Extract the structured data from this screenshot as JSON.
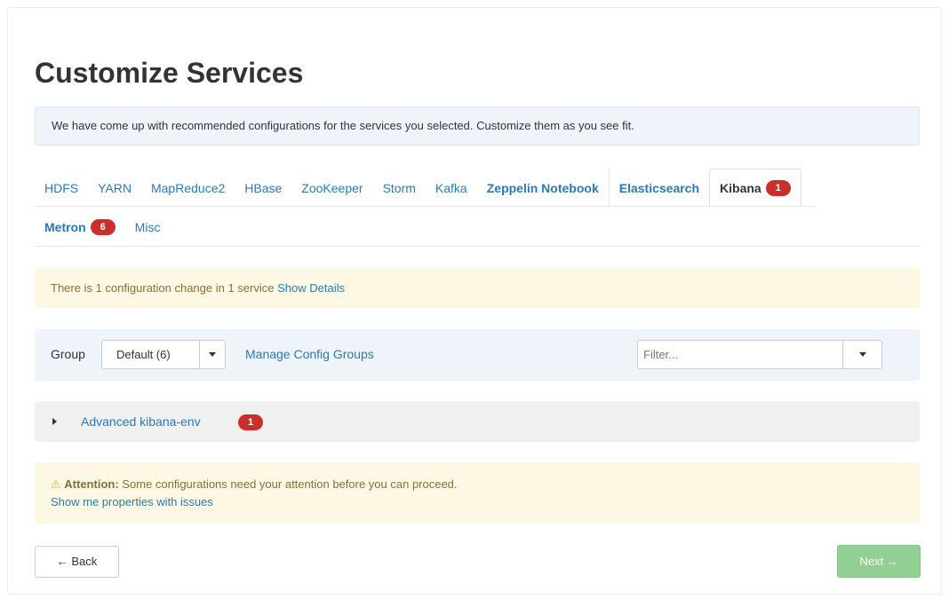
{
  "page": {
    "title": "Customize Services",
    "info_message": "We have come up with recommended configurations for the services you selected. Customize them as you see fit."
  },
  "tabs": [
    {
      "label": "HDFS"
    },
    {
      "label": "YARN"
    },
    {
      "label": "MapReduce2"
    },
    {
      "label": "HBase"
    },
    {
      "label": "ZooKeeper"
    },
    {
      "label": "Storm"
    },
    {
      "label": "Kafka"
    },
    {
      "label": "Zeppelin Notebook"
    },
    {
      "label": "Elasticsearch"
    },
    {
      "label": "Kibana",
      "badge": "1",
      "active": true
    },
    {
      "label": "Metron",
      "badge": "6"
    },
    {
      "label": "Misc"
    }
  ],
  "change_notice": {
    "text": "There is 1 configuration change in 1 service",
    "link": "Show Details"
  },
  "group_bar": {
    "label": "Group",
    "selected": "Default (6)",
    "manage_link": "Manage Config Groups",
    "filter_placeholder": "Filter..."
  },
  "section": {
    "title": "Advanced kibana-env",
    "badge": "1"
  },
  "attention": {
    "label": "Attention:",
    "message": "Some configurations need your attention before you can proceed.",
    "link": "Show me properties with issues"
  },
  "buttons": {
    "back": "← Back",
    "next": "Next →"
  },
  "colors": {
    "link": "#2a7ab7",
    "badge": "#c9302c",
    "next_button": "#92cf92",
    "warning_bg": "#fcf8e3",
    "info_bg": "#eef4fa"
  }
}
